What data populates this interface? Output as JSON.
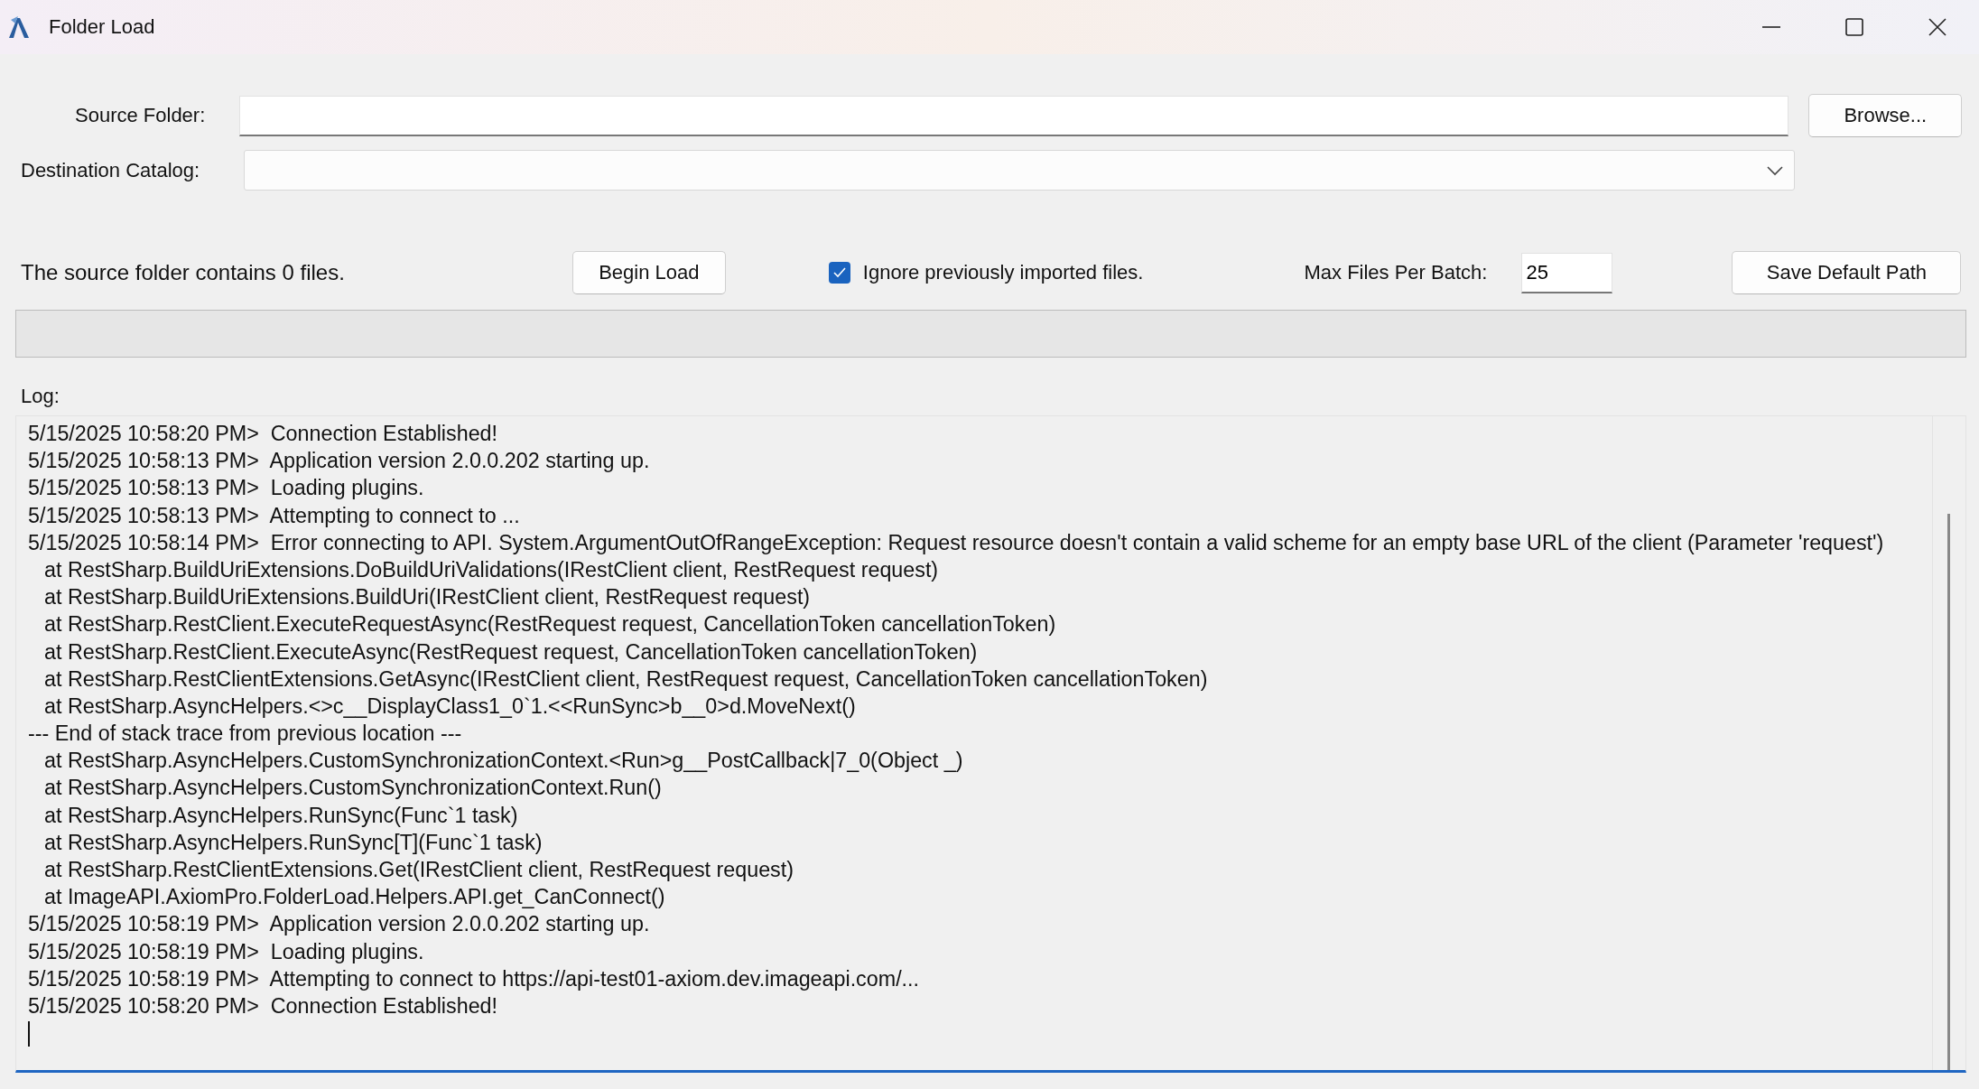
{
  "window": {
    "title": "Folder Load"
  },
  "source_folder": {
    "label": "Source Folder:",
    "browse_button": "Browse..."
  },
  "destination_catalog": {
    "label": "Destination Catalog:"
  },
  "status_text": "The source folder contains 0 files.",
  "begin_button": "Begin Load",
  "ignore_checkbox": {
    "label": "Ignore previously imported files.",
    "checked": true
  },
  "max_files": {
    "label": "Max Files Per Batch:",
    "value": "25"
  },
  "save_button": "Save Default Path",
  "progress": {
    "level": 0
  },
  "log": {
    "label": "Log:",
    "lines": [
      {
        "kind": "entry",
        "text": "5/15/2025 10:58:20 PM>  Connection Established!"
      },
      {
        "kind": "entry",
        "text": "5/15/2025 10:58:13 PM>  Application version 2.0.0.202 starting up."
      },
      {
        "kind": "entry",
        "text": "5/15/2025 10:58:13 PM>  Loading plugins."
      },
      {
        "kind": "entry",
        "text": "5/15/2025 10:58:13 PM>  Attempting to connect to ..."
      },
      {
        "kind": "entry",
        "text": "5/15/2025 10:58:14 PM>  Error connecting to API. System.ArgumentOutOfRangeException: Request resource doesn't contain a valid scheme for an empty base URL of the client (Parameter 'request')"
      },
      {
        "kind": "trace",
        "text": "at RestSharp.BuildUriExtensions.DoBuildUriValidations(IRestClient client, RestRequest request)"
      },
      {
        "kind": "trace",
        "text": "at RestSharp.BuildUriExtensions.BuildUri(IRestClient client, RestRequest request)"
      },
      {
        "kind": "trace",
        "text": "at RestSharp.RestClient.ExecuteRequestAsync(RestRequest request, CancellationToken cancellationToken)"
      },
      {
        "kind": "trace",
        "text": "at RestSharp.RestClient.ExecuteAsync(RestRequest request, CancellationToken cancellationToken)"
      },
      {
        "kind": "trace",
        "text": "at RestSharp.RestClientExtensions.GetAsync(IRestClient client, RestRequest request, CancellationToken cancellationToken)"
      },
      {
        "kind": "trace",
        "text": "at RestSharp.AsyncHelpers.<>c__DisplayClass1_0`1.<<RunSync>b__0>d.MoveNext()"
      },
      {
        "kind": "entry",
        "text": "--- End of stack trace from previous location ---"
      },
      {
        "kind": "trace",
        "text": "at RestSharp.AsyncHelpers.CustomSynchronizationContext.<Run>g__PostCallback|7_0(Object _)"
      },
      {
        "kind": "trace",
        "text": "at RestSharp.AsyncHelpers.CustomSynchronizationContext.Run()"
      },
      {
        "kind": "trace",
        "text": "at RestSharp.AsyncHelpers.RunSync(Func`1 task)"
      },
      {
        "kind": "trace",
        "text": "at RestSharp.AsyncHelpers.RunSync[T](Func`1 task)"
      },
      {
        "kind": "trace",
        "text": "at RestSharp.RestClientExtensions.Get(IRestClient client, RestRequest request)"
      },
      {
        "kind": "trace",
        "text": "at ImageAPI.AxiomPro.FolderLoad.Helpers.API.get_CanConnect()"
      },
      {
        "kind": "entry",
        "text": "5/15/2025 10:58:19 PM>  Application version 2.0.0.202 starting up."
      },
      {
        "kind": "entry",
        "text": "5/15/2025 10:58:19 PM>  Loading plugins."
      },
      {
        "kind": "entry",
        "text": "5/15/2025 10:58:19 PM>  Attempting to connect to https://api-test01-axiom.dev.imageapi.com/..."
      },
      {
        "kind": "entry",
        "text": "5/15/2025 10:58:20 PM>  Connection Established!"
      }
    ]
  }
}
